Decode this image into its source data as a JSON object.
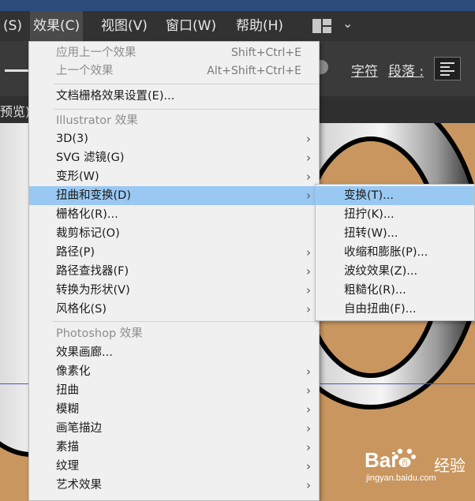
{
  "menubar": {
    "items": [
      "(S)",
      "效果(C)",
      "视图(V)",
      "窗口(W)",
      "帮助(H)"
    ],
    "active": "效果(C)"
  },
  "control_bar": {
    "character_label": "字符",
    "paragraph_label": "段落 :"
  },
  "tab": {
    "label": "预览)"
  },
  "effect_menu": {
    "items": [
      {
        "label": "应用上一个效果",
        "shortcut": "Shift+Ctrl+E",
        "disabled": true
      },
      {
        "label": "上一个效果",
        "shortcut": "Alt+Shift+Ctrl+E",
        "disabled": true
      },
      {
        "label": "文档栅格效果设置(E)..."
      },
      {
        "label": "Illustrator 效果",
        "header": true
      },
      {
        "label": "3D(3)",
        "submenu": true
      },
      {
        "label": "SVG 滤镜(G)",
        "submenu": true
      },
      {
        "label": "变形(W)",
        "submenu": true
      },
      {
        "label": "扭曲和变换(D)",
        "submenu": true,
        "highlighted": true
      },
      {
        "label": "栅格化(R)..."
      },
      {
        "label": "裁剪标记(O)"
      },
      {
        "label": "路径(P)",
        "submenu": true
      },
      {
        "label": "路径查找器(F)",
        "submenu": true
      },
      {
        "label": "转换为形状(V)",
        "submenu": true
      },
      {
        "label": "风格化(S)",
        "submenu": true
      },
      {
        "label": "Photoshop 效果",
        "header": true
      },
      {
        "label": "效果画廊..."
      },
      {
        "label": "像素化",
        "submenu": true
      },
      {
        "label": "扭曲",
        "submenu": true
      },
      {
        "label": "模糊",
        "submenu": true
      },
      {
        "label": "画笔描边",
        "submenu": true
      },
      {
        "label": "素描",
        "submenu": true
      },
      {
        "label": "纹理",
        "submenu": true
      },
      {
        "label": "艺术效果",
        "submenu": true
      }
    ]
  },
  "distort_submenu": {
    "items": [
      {
        "label": "变换(T)...",
        "highlighted": true
      },
      {
        "label": "扭拧(K)..."
      },
      {
        "label": "扭转(W)..."
      },
      {
        "label": "收缩和膨胀(P)..."
      },
      {
        "label": "波纹效果(Z)..."
      },
      {
        "label": "粗糙化(R)..."
      },
      {
        "label": "自由扭曲(F)..."
      }
    ]
  },
  "watermark": {
    "logo": "Bai",
    "logo2": "百",
    "text": "经验",
    "url": "jingyan.baidu.com"
  }
}
